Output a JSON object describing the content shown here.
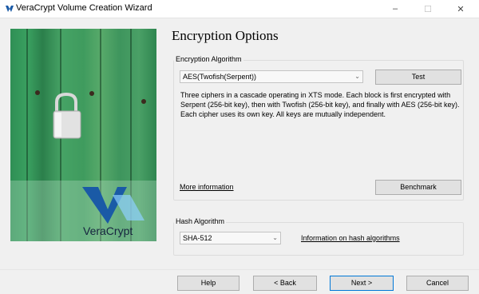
{
  "window": {
    "title": "VeraCrypt Volume Creation Wizard"
  },
  "brand": {
    "logo_text": "VeraCrypt"
  },
  "page": {
    "title": "Encryption Options"
  },
  "encryption": {
    "group_label": "Encryption Algorithm",
    "selected": "AES(Twofish(Serpent))",
    "test_label": "Test",
    "description": "Three ciphers in a cascade operating in XTS mode. Each block is first encrypted with Serpent (256-bit key), then with Twofish (256-bit key), and finally with AES (256-bit key). Each cipher uses its own key. All keys are mutually independent.",
    "more_info_label": "More information",
    "benchmark_label": "Benchmark"
  },
  "hash": {
    "group_label": "Hash Algorithm",
    "selected": "SHA-512",
    "info_label": "Information on hash algorithms"
  },
  "footer": {
    "help_label": "Help",
    "back_label": "< Back",
    "next_label": "Next >",
    "cancel_label": "Cancel"
  },
  "icons": {
    "app": "veracrypt-icon",
    "minimize": "minimize-icon",
    "maximize": "maximize-icon",
    "close": "close-icon",
    "dropdown": "chevron-down-icon"
  },
  "colors": {
    "accent": "#0078d7",
    "logo_blue": "#1a5aa6",
    "door_green": "#3a9a5e"
  }
}
